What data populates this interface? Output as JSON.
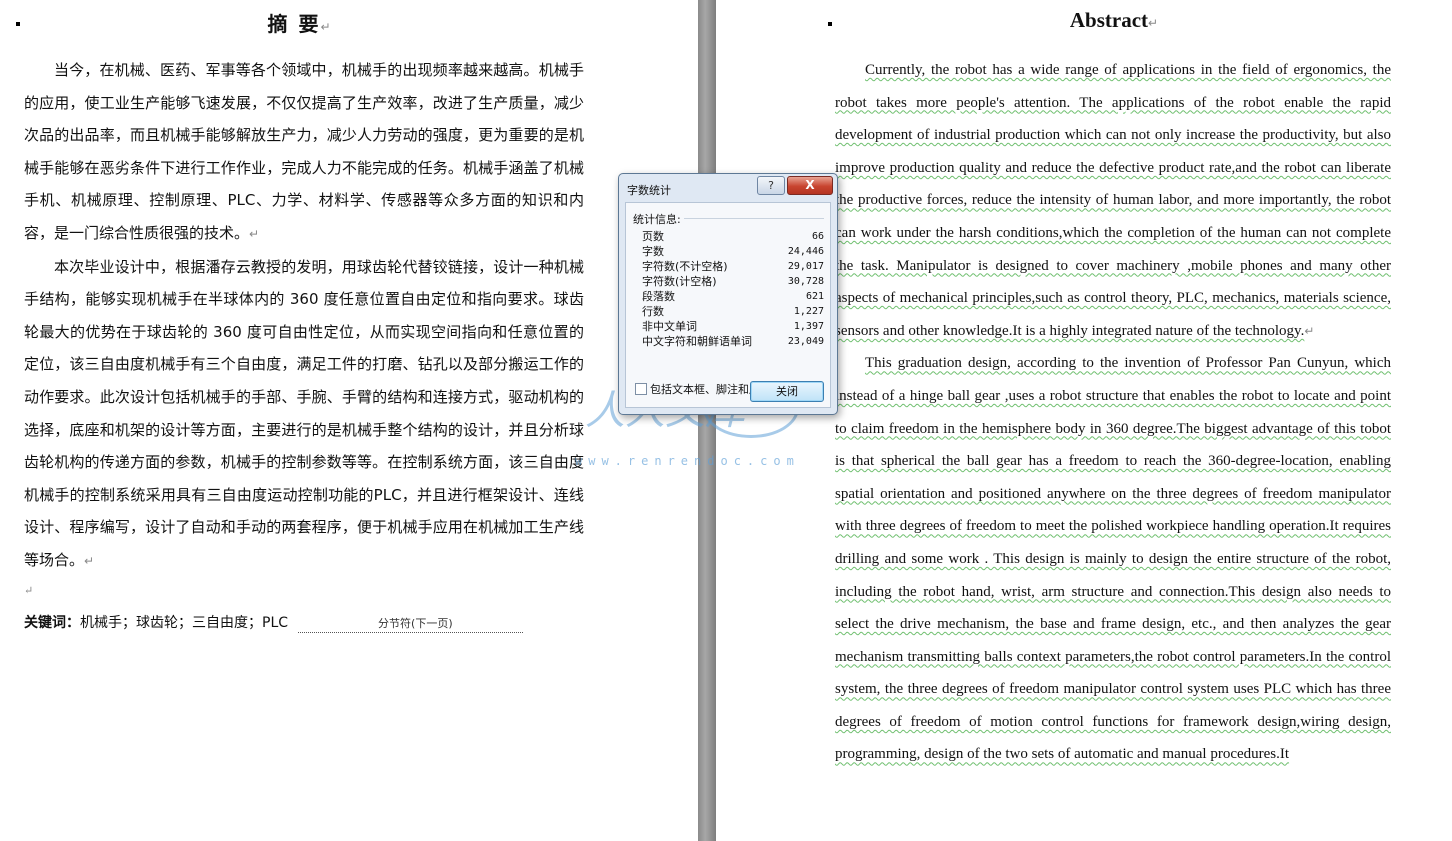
{
  "left_page": {
    "title": "摘  要",
    "paragraphs": [
      "当今，在机械、医药、军事等各个领域中，机械手的出现频率越来越高。机械手的应用，使工业生产能够飞速发展，不仅仅提高了生产效率，改进了生产质量，减少次品的出品率，而且机械手能够解放生产力，减少人力劳动的强度，更为重要的是机械手能够在恶劣条件下进行工作作业，完成人力不能完成的任务。机械手涵盖了机械手机、机械原理、控制原理、PLC、力学、材料学、传感器等众多方面的知识和内容，是一门综合性质很强的技术。",
      "本次毕业设计中，根据潘存云教授的发明，用球齿轮代替铰链接，设计一种机械手结构，能够实现机械手在半球体内的 360 度任意位置自由定位和指向要求。球齿轮最大的优势在于球齿轮的 360 度可自由性定位，从而实现空间指向和任意位置的定位，该三自由度机械手有三个自由度，满足工件的打磨、钻孔以及部分搬运工作的动作要求。此次设计包括机械手的手部、手腕、手臂的结构和连接方式，驱动机构的选择，底座和机架的设计等方面，主要进行的是机械手整个结构的设计，并且分析球齿轮机构的传递方面的参数，机械手的控制参数等等。在控制系统方面，该三自由度机械手的控制系统采用具有三自由度运动控制功能的PLC，并且进行框架设计、连线设计、程序编写，设计了自动和手动的两套程序，便于机械手应用在机械加工生产线等场合。"
    ],
    "keywords_label": "关键词：",
    "keywords": "机械手；球齿轮；三自由度；PLC",
    "section_break": "分节符(下一页)"
  },
  "right_page": {
    "title": "Abstract",
    "paragraphs": [
      "Currently, the robot has a wide range of applications in the field of ergonomics, the robot takes more people's attention. The applications of the robot enable the rapid development of industrial production which can not only increase the productivity, but also improve production quality and reduce the defective product rate,and the robot can liberate the productive forces, reduce the intensity of human labor, and more importantly, the robot can work under the harsh conditions,which the completion of the human can not complete the task. Manipulator is designed to cover machinery ,mobile phones and many other aspects of mechanical principles,such as control theory, PLC, mechanics, materials science, sensors and other knowledge.It is a highly integrated nature of the technology.",
      "This graduation design, according to the invention of Professor Pan Cunyun, which instead of a hinge ball gear ,uses a robot structure that enables the robot to locate and point to claim freedom in the hemisphere body in 360 degree.The biggest advantage of this tobot is that spherical the ball gear has a freedom to reach the 360-degree-location, enabling spatial orientation and positioned anywhere on the three degrees of freedom manipulator with three degrees of freedom to meet the polished workpiece handling operation.It requires drilling and some work . This design is mainly to design the entire structure of the robot, including the robot hand, wrist, arm structure and connection.This design also needs to select the drive mechanism, the base and frame design, etc., and then analyzes the gear mechanism transmitting balls context parameters,the robot control parameters.In the control system, the three degrees of freedom manipulator control system uses PLC which has three degrees of freedom of motion control functions for framework design,wiring design, programming, design of the two sets of automatic and manual procedures.It"
    ]
  },
  "dialog": {
    "title": "字数统计",
    "help_label": "?",
    "close_x": "X",
    "stats_heading": "统计信息:",
    "stats": [
      {
        "label": "页数",
        "value": "66"
      },
      {
        "label": "字数",
        "value": "24,446"
      },
      {
        "label": "字符数(不计空格)",
        "value": "29,017"
      },
      {
        "label": "字符数(计空格)",
        "value": "30,728"
      },
      {
        "label": "段落数",
        "value": "621"
      },
      {
        "label": "行数",
        "value": "1,227"
      },
      {
        "label": "非中文单词",
        "value": "1,397"
      },
      {
        "label": "中文字符和朝鲜语单词",
        "value": "23,049"
      }
    ],
    "checkbox_label": "包括文本框、脚注和尾注(F)",
    "checkbox_checked": false,
    "close_button": "关闭"
  },
  "watermark": {
    "text": "人人文库",
    "url": "www.renrendoc.com"
  },
  "colors": {
    "grammar_underline": "#6fbf6f",
    "spelling_underline": "#d04545",
    "close_red": "#c8442f"
  }
}
